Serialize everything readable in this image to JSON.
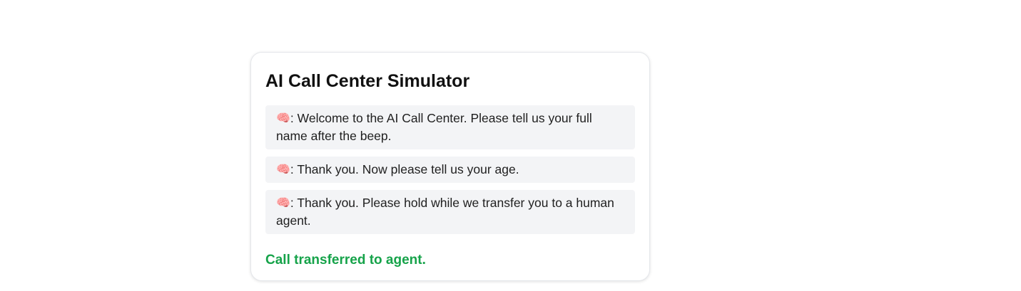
{
  "app": {
    "title": "AI Call Center Simulator"
  },
  "icons": {
    "speaker": "🧠"
  },
  "messages": [
    {
      "speaker_icon": "brain-icon",
      "text": ": Welcome to the AI Call Center. Please tell us your full name after the beep."
    },
    {
      "speaker_icon": "brain-icon",
      "text": ": Thank you. Now please tell us your age."
    },
    {
      "speaker_icon": "brain-icon",
      "text": ": Thank you. Please hold while we transfer you to a human agent."
    }
  ],
  "status": {
    "text": "Call transferred to agent.",
    "color": "#16a34a"
  }
}
